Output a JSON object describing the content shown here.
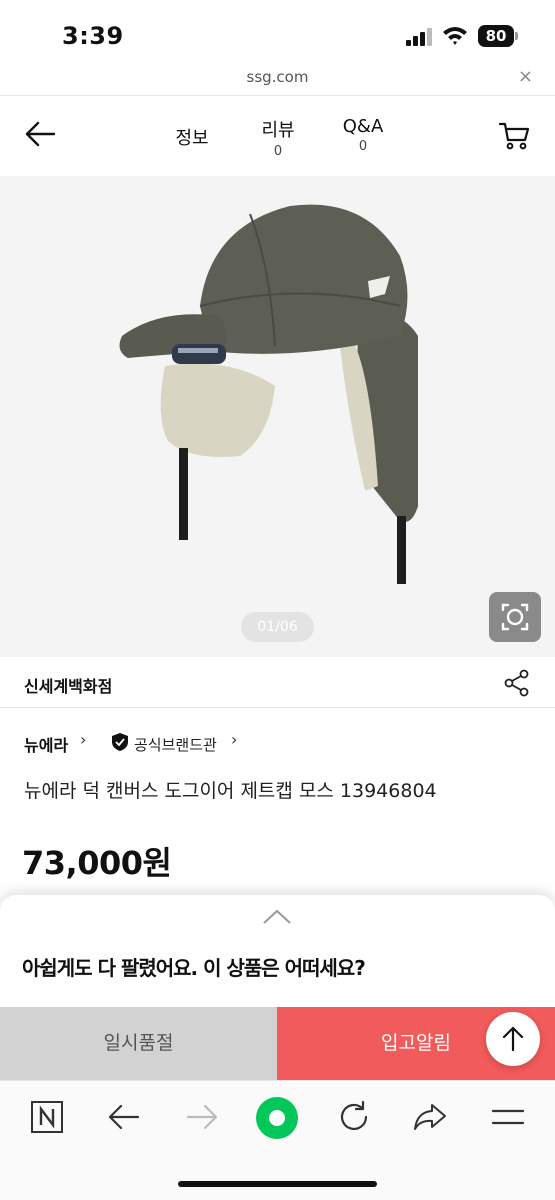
{
  "status_bar": {
    "time": "3:39",
    "battery": "80"
  },
  "url_bar": {
    "domain": "ssg.com",
    "close_label": "×"
  },
  "header": {
    "tabs": [
      {
        "label": "정보"
      },
      {
        "label": "리뷰",
        "count": "0"
      },
      {
        "label": "Q&A",
        "count": "0"
      }
    ]
  },
  "gallery": {
    "page_indicator": "01/06"
  },
  "seller": {
    "name": "신세계백화점"
  },
  "brand": {
    "name": "뉴에라",
    "official_label": "공식브랜드관",
    "chevron": "›"
  },
  "product": {
    "title": "뉴에라 덕 캔버스 도그이어 제트캡 모스 13946804",
    "price": "73,000원"
  },
  "sheet": {
    "message": "아쉽게도 다 팔렸어요. 이 상품은 어떠세요?"
  },
  "actions": {
    "soldout_label": "일시품절",
    "restock_label": "입고알림"
  },
  "colors": {
    "accent_red": "#f25b5b",
    "soldout_gray": "#d2d2d2",
    "naver_green": "#03c75a",
    "hat_olive": "#5a5c52",
    "lining_beige": "#d8d6c2"
  },
  "icons": [
    "back-arrow-icon",
    "cart-icon",
    "lens-icon",
    "share-icon",
    "shield-check-icon",
    "chevron-up-icon",
    "arrow-up-icon",
    "naver-n-icon",
    "forward-arrow-icon",
    "green-dot-icon",
    "refresh-icon",
    "share-forward-icon",
    "menu-icon"
  ]
}
